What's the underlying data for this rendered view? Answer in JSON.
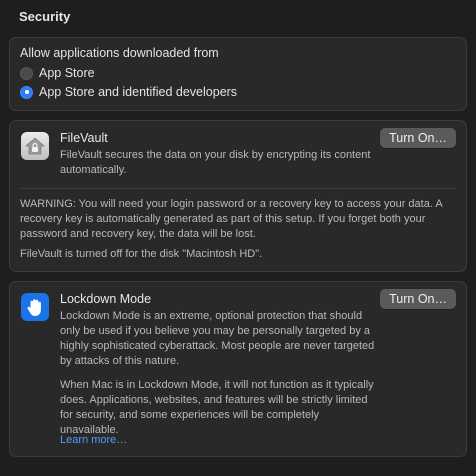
{
  "section": {
    "title": "Security"
  },
  "allow_downloads": {
    "title": "Allow applications downloaded from",
    "options": [
      {
        "label": "App Store",
        "selected": false
      },
      {
        "label": "App Store and identified developers",
        "selected": true
      }
    ]
  },
  "filevault": {
    "icon": "house-lock-icon",
    "title": "FileVault",
    "description": "FileVault secures the data on your disk by encrypting its content automatically.",
    "button_label": "Turn On…",
    "warning": "WARNING: You will need your login password or a recovery key to access your data. A recovery key is automatically generated as part of this setup. If you forget both your password and recovery key, the data will be lost.",
    "status": "FileVault is turned off for the disk \"Macintosh HD\"."
  },
  "lockdown": {
    "icon": "raised-hand-icon",
    "title": "Lockdown Mode",
    "description": "Lockdown Mode is an extreme, optional protection that should only be used if you believe you may be personally targeted by a highly sophisticated cyberattack. Most people are never targeted by attacks of this nature.",
    "description2": "When Mac is in Lockdown Mode, it will not function as it typically does. Applications, websites, and features will be strictly limited for security, and some experiences will be completely unavailable.",
    "learn_more": "Learn more…",
    "button_label": "Turn On…"
  },
  "colors": {
    "background": "#1f1e1f",
    "card": "#2a292a",
    "accent": "#2f7cf6",
    "link": "#4f9cf9"
  }
}
